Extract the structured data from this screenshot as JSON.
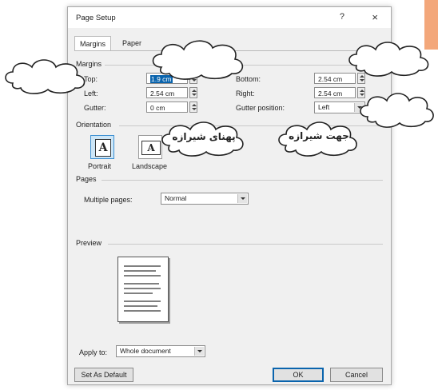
{
  "dialog": {
    "title": "Page Setup",
    "help_label": "?",
    "close_label": "×"
  },
  "tabs": [
    {
      "label": "Margins"
    },
    {
      "label": "Paper"
    }
  ],
  "margins": {
    "section": "Margins",
    "top": {
      "label": "Top:",
      "value": "1.9 cm"
    },
    "bottom": {
      "label": "Bottom:",
      "value": "2.54 cm"
    },
    "left": {
      "label": "Left:",
      "value": "2.54 cm"
    },
    "right": {
      "label": "Right:",
      "value": "2.54 cm"
    },
    "gutter": {
      "label": "Gutter:",
      "value": "0 cm"
    },
    "gutter_position": {
      "label": "Gutter position:",
      "value": "Left"
    }
  },
  "orientation": {
    "section": "Orientation",
    "portrait": "Portrait",
    "landscape": "Landscape",
    "glyph": "A"
  },
  "pages": {
    "section": "Pages",
    "multiple_label": "Multiple pages:",
    "multiple_value": "Normal"
  },
  "preview": {
    "section": "Preview"
  },
  "apply": {
    "label": "Apply to:",
    "value": "Whole document"
  },
  "buttons": {
    "default": "Set As Default",
    "ok": "OK",
    "cancel": "Cancel"
  },
  "callouts": {
    "gutter_width": "پهنای شیرازه",
    "gutter_direction": "جهت شیرازه"
  },
  "colors": {
    "accent": "#0a64ad",
    "orange_tab": "#f3a77a",
    "dialog_bg": "#f0f0f0"
  }
}
